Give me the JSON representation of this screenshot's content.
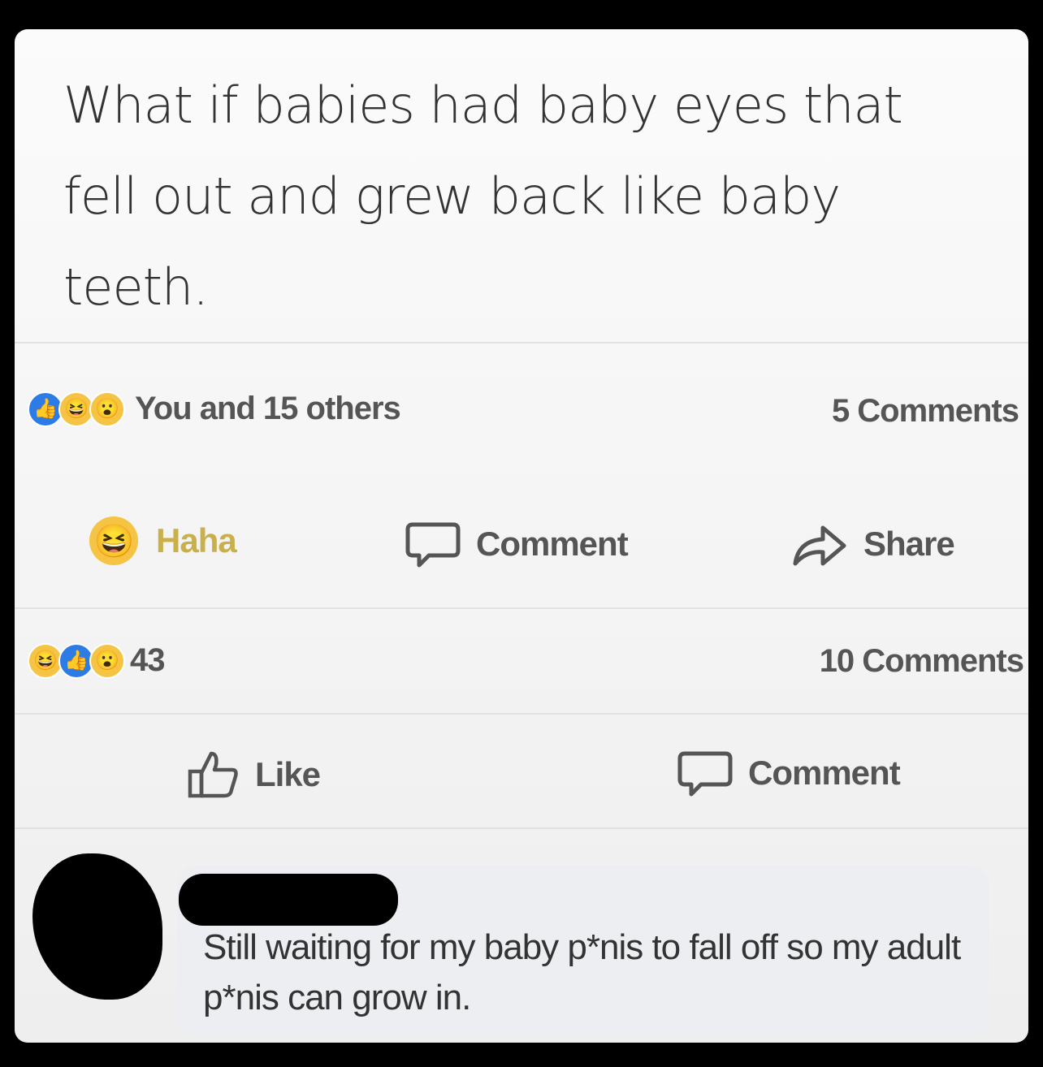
{
  "post": {
    "text": "What if babies had baby eyes that fell out and grew back like baby teeth."
  },
  "post_stats": {
    "reactions_summary": "You and 15 others",
    "comments_count": "5 Comments",
    "reaction_icons": [
      "like-icon",
      "haha-icon",
      "wow-icon"
    ]
  },
  "post_actions": {
    "haha_label": "Haha",
    "comment_label": "Comment",
    "share_label": "Share"
  },
  "shared_stats": {
    "reaction_count": "43",
    "comments_count": "10 Comments",
    "reaction_icons": [
      "haha-icon",
      "like-icon",
      "wow-icon"
    ]
  },
  "shared_actions": {
    "like_label": "Like",
    "comment_label": "Comment"
  },
  "comment": {
    "text": "Still waiting for my baby p*nis to fall off so my adult p*nis can grow in."
  },
  "colors": {
    "like_blue": "#2d7be5",
    "reaction_yellow": "#f6c445",
    "text_gray": "#555555"
  }
}
